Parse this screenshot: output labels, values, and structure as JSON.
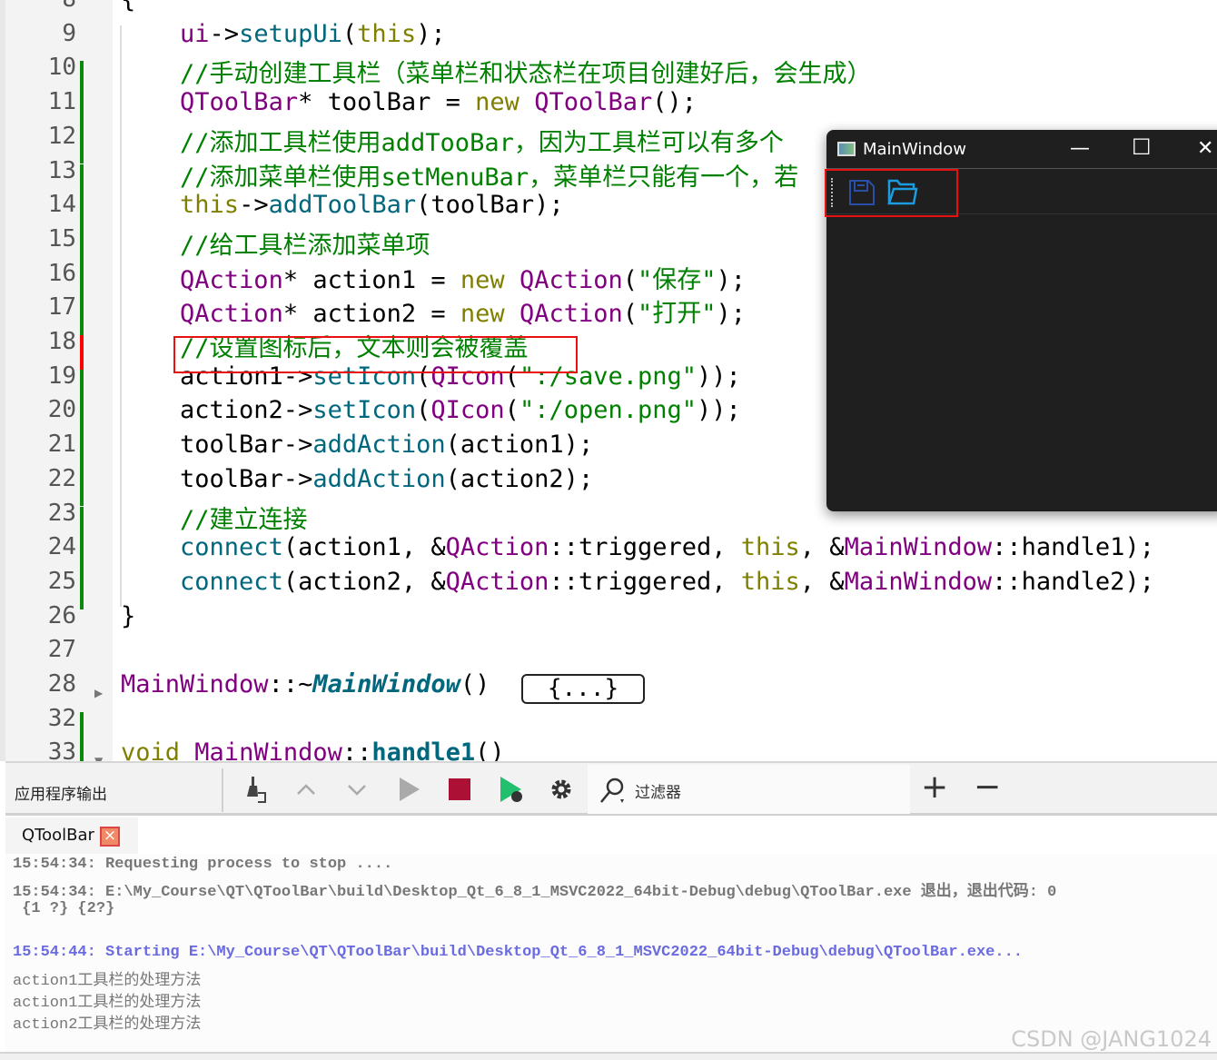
{
  "editor": {
    "lines": [
      {
        "n": "8",
        "marker": "",
        "tokens": [
          [
            "{",
            "pl"
          ]
        ]
      },
      {
        "n": "9",
        "marker": "",
        "tokens": [
          [
            "    ",
            "pl"
          ],
          [
            "ui",
            "ty"
          ],
          [
            "->",
            "pl"
          ],
          [
            "setupUi",
            "fn"
          ],
          [
            "(",
            "pl"
          ],
          [
            "this",
            "kw"
          ],
          [
            ");",
            "pl"
          ]
        ]
      },
      {
        "n": "10",
        "marker": "green",
        "tokens": [
          [
            "    //手动创建工具栏（菜单栏和状态栏在项目创建好后，会生成）",
            "cm"
          ]
        ]
      },
      {
        "n": "11",
        "marker": "green",
        "tokens": [
          [
            "    ",
            "pl"
          ],
          [
            "QToolBar",
            "ty"
          ],
          [
            "* toolBar = ",
            "pl"
          ],
          [
            "new",
            "kw"
          ],
          [
            " ",
            "pl"
          ],
          [
            "QToolBar",
            "ty"
          ],
          [
            "();",
            "pl"
          ]
        ]
      },
      {
        "n": "12",
        "marker": "green",
        "tokens": [
          [
            "    //添加工具栏使用addTooBar，因为工具栏可以有多个",
            "cm"
          ]
        ]
      },
      {
        "n": "13",
        "marker": "green",
        "tokens": [
          [
            "    //添加菜单栏使用setMenuBar，菜单栏只能有一个，若",
            "cm"
          ]
        ]
      },
      {
        "n": "14",
        "marker": "green",
        "tokens": [
          [
            "    ",
            "pl"
          ],
          [
            "this",
            "kw"
          ],
          [
            "->",
            "pl"
          ],
          [
            "addToolBar",
            "fn"
          ],
          [
            "(toolBar);",
            "pl"
          ]
        ]
      },
      {
        "n": "15",
        "marker": "green",
        "tokens": [
          [
            "    //给工具栏添加菜单项",
            "cm"
          ]
        ]
      },
      {
        "n": "16",
        "marker": "green",
        "tokens": [
          [
            "    ",
            "pl"
          ],
          [
            "QAction",
            "ty"
          ],
          [
            "* action1 = ",
            "pl"
          ],
          [
            "new",
            "kw"
          ],
          [
            " ",
            "pl"
          ],
          [
            "QAction",
            "ty"
          ],
          [
            "(",
            "pl"
          ],
          [
            "\"保存\"",
            "st"
          ],
          [
            ");",
            "pl"
          ]
        ]
      },
      {
        "n": "17",
        "marker": "green",
        "tokens": [
          [
            "    ",
            "pl"
          ],
          [
            "QAction",
            "ty"
          ],
          [
            "* action2 = ",
            "pl"
          ],
          [
            "new",
            "kw"
          ],
          [
            " ",
            "pl"
          ],
          [
            "QAction",
            "ty"
          ],
          [
            "(",
            "pl"
          ],
          [
            "\"打开\"",
            "st"
          ],
          [
            ");",
            "pl"
          ]
        ]
      },
      {
        "n": "18",
        "marker": "red",
        "tokens": [
          [
            "    //设置图标后，文本则会被覆盖",
            "cm"
          ]
        ]
      },
      {
        "n": "19",
        "marker": "green",
        "tokens": [
          [
            "    action1->",
            "pl"
          ],
          [
            "setIcon",
            "fn"
          ],
          [
            "(",
            "pl"
          ],
          [
            "QIcon",
            "ty"
          ],
          [
            "(",
            "pl"
          ],
          [
            "\":/save.png\"",
            "st"
          ],
          [
            "));",
            "pl"
          ]
        ]
      },
      {
        "n": "20",
        "marker": "green",
        "tokens": [
          [
            "    action2->",
            "pl"
          ],
          [
            "setIcon",
            "fn"
          ],
          [
            "(",
            "pl"
          ],
          [
            "QIcon",
            "ty"
          ],
          [
            "(",
            "pl"
          ],
          [
            "\":/open.png\"",
            "st"
          ],
          [
            "));",
            "pl"
          ]
        ]
      },
      {
        "n": "21",
        "marker": "green",
        "tokens": [
          [
            "    toolBar->",
            "pl"
          ],
          [
            "addAction",
            "fn"
          ],
          [
            "(action1);",
            "pl"
          ]
        ]
      },
      {
        "n": "22",
        "marker": "green",
        "tokens": [
          [
            "    toolBar->",
            "pl"
          ],
          [
            "addAction",
            "fn"
          ],
          [
            "(action2);",
            "pl"
          ]
        ]
      },
      {
        "n": "23",
        "marker": "green",
        "tokens": [
          [
            "    //建立连接",
            "cm"
          ]
        ]
      },
      {
        "n": "24",
        "marker": "green",
        "tokens": [
          [
            "    ",
            "pl"
          ],
          [
            "connect",
            "fn"
          ],
          [
            "(action1, &",
            "pl"
          ],
          [
            "QAction",
            "ty"
          ],
          [
            "::triggered, ",
            "pl"
          ],
          [
            "this",
            "kw"
          ],
          [
            ", &",
            "pl"
          ],
          [
            "MainWindow",
            "ty"
          ],
          [
            "::handle1);",
            "pl"
          ]
        ]
      },
      {
        "n": "25",
        "marker": "green",
        "tokens": [
          [
            "    ",
            "pl"
          ],
          [
            "connect",
            "fn"
          ],
          [
            "(action2, &",
            "pl"
          ],
          [
            "QAction",
            "ty"
          ],
          [
            "::triggered, ",
            "pl"
          ],
          [
            "this",
            "kw"
          ],
          [
            ", &",
            "pl"
          ],
          [
            "MainWindow",
            "ty"
          ],
          [
            "::handle2);",
            "pl"
          ]
        ]
      },
      {
        "n": "26",
        "marker": "",
        "tokens": [
          [
            "}",
            "pl"
          ]
        ]
      },
      {
        "n": "27",
        "marker": "",
        "tokens": []
      },
      {
        "n": "28",
        "marker": "",
        "fold": "collapsed",
        "tokens": [
          [
            "MainWindow",
            "ty"
          ],
          [
            "::~",
            "pl"
          ],
          [
            "MainWindow",
            "it"
          ],
          [
            "()",
            "pl"
          ]
        ]
      },
      {
        "n": "32",
        "marker": "green",
        "tokens": []
      },
      {
        "n": "33",
        "marker": "green",
        "fold": "expanded",
        "tokens": [
          [
            "void",
            "kw"
          ],
          [
            " ",
            "pl"
          ],
          [
            "MainWindow",
            "ty"
          ],
          [
            "::",
            "pl"
          ],
          [
            "handle1",
            "bd"
          ],
          [
            "()",
            "pl"
          ]
        ]
      }
    ],
    "folded_placeholder": "{...}"
  },
  "preview_window": {
    "title": "MainWindow",
    "minimize": "—",
    "maximize": "☐",
    "close": "✕",
    "toolbar_actions": [
      {
        "name": "保存",
        "icon": "save-icon",
        "color": "#2a4fa8"
      },
      {
        "name": "打开",
        "icon": "folder-open-icon",
        "color": "#1b9be0"
      }
    ]
  },
  "output_panel": {
    "title": "应用程序输出",
    "filter_placeholder": "过滤器",
    "add": "+",
    "remove": "−",
    "tab": "QToolBar",
    "tab_close": "×",
    "stop_color": "#ad1035",
    "run_debug_color": "#22c06e",
    "lines": [
      {
        "text": "15:54:34: Requesting process to stop ....",
        "style": "bold"
      },
      {
        "text": "15:54:34: E:\\My_Course\\QT\\QToolBar\\build\\Desktop_Qt_6_8_1_MSVC2022_64bit-Debug\\debug\\QToolBar.exe 退出，退出代码: 0",
        "style": "bold"
      },
      {
        "text": " {1 ?} {2?}",
        "style": "bold"
      },
      {
        "text": "",
        "style": ""
      },
      {
        "text": "15:54:44: Starting E:\\My_Course\\QT\\QToolBar\\build\\Desktop_Qt_6_8_1_MSVC2022_64bit-Debug\\debug\\QToolBar.exe...",
        "style": "blue"
      },
      {
        "text": "action1工具栏的处理方法",
        "style": ""
      },
      {
        "text": "action1工具栏的处理方法",
        "style": ""
      },
      {
        "text": "action2工具栏的处理方法",
        "style": ""
      }
    ]
  },
  "watermark": "CSDN @JANG1024"
}
